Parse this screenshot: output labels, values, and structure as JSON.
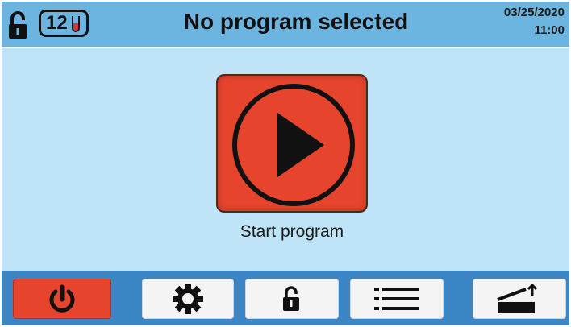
{
  "header": {
    "title": "No program selected",
    "sample_count": "12",
    "date": "03/25/2020",
    "time": "11:00",
    "lock_state": "unlocked"
  },
  "main": {
    "start_label": "Start program"
  },
  "toolbar": {
    "buttons": [
      {
        "name": "power",
        "icon": "power-icon"
      },
      {
        "name": "settings",
        "icon": "gear-icon"
      },
      {
        "name": "lock",
        "icon": "unlock-icon"
      },
      {
        "name": "menu",
        "icon": "list-icon"
      },
      {
        "name": "door",
        "icon": "lid-open-icon"
      }
    ]
  },
  "colors": {
    "header_bg": "#6cb5e0",
    "screen_bg": "#bfe4f7",
    "toolbar_bg": "#3d86c6",
    "accent_red": "#e6442c"
  }
}
